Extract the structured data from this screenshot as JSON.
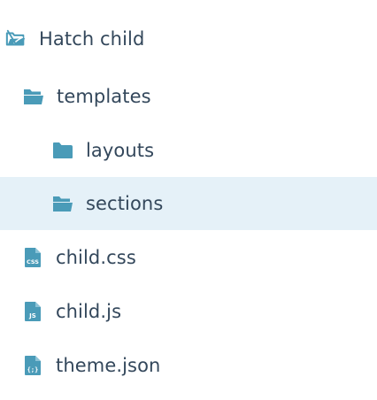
{
  "tree": {
    "root": {
      "label": "Hatch child",
      "icon": "theme-folder-icon"
    },
    "templates": {
      "label": "templates",
      "icon": "folder-open-icon",
      "expanded": true
    },
    "layouts": {
      "label": "layouts",
      "icon": "folder-icon"
    },
    "sections": {
      "label": "sections",
      "icon": "folder-open-icon",
      "selected": true
    },
    "child_css": {
      "label": "child.css",
      "icon": "css-file-icon",
      "badge": "CSS"
    },
    "child_js": {
      "label": "child.js",
      "icon": "js-file-icon",
      "badge": "JS"
    },
    "theme_json": {
      "label": "theme.json",
      "icon": "json-file-icon",
      "badge": "{;}"
    }
  },
  "colors": {
    "icon": "#4a9bb8",
    "text": "#33475b",
    "selected_bg": "#e5f1f8"
  }
}
